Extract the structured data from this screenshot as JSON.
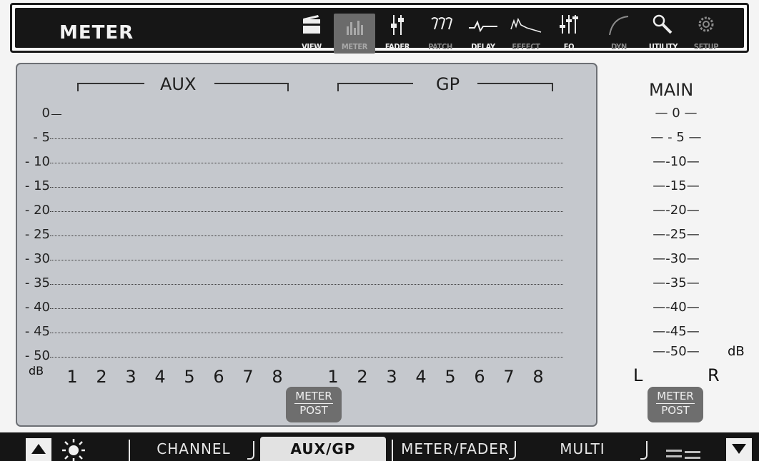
{
  "header": {
    "title": "METER",
    "nav": [
      {
        "label": "VIEW",
        "icon": "view-icon",
        "state": "normal"
      },
      {
        "label": "METER",
        "icon": "meter-icon",
        "state": "active"
      },
      {
        "label": "FADER",
        "icon": "fader-icon",
        "state": "normal"
      },
      {
        "label": "PATCH",
        "icon": "patch-icon",
        "state": "dim"
      },
      {
        "label": "DELAY",
        "icon": "delay-icon",
        "state": "normal"
      },
      {
        "label": "EFFECT",
        "icon": "effect-icon",
        "state": "dim"
      },
      {
        "label": "EQ",
        "icon": "eq-icon",
        "state": "normal"
      },
      {
        "label": "DYN",
        "icon": "dyn-icon",
        "state": "dim"
      },
      {
        "label": "UTILITY",
        "icon": "utility-icon",
        "state": "normal"
      },
      {
        "label": "SETUP",
        "icon": "setup-icon",
        "state": "dim"
      }
    ]
  },
  "panel": {
    "aux_label": "AUX",
    "gp_label": "GP",
    "scale": [
      "0",
      "- 5",
      "- 10",
      "- 15",
      "- 20",
      "- 25",
      "- 30",
      "- 35",
      "- 40",
      "- 45",
      "- 50"
    ],
    "db_label": "dB",
    "aux_channels": [
      "1",
      "2",
      "3",
      "4",
      "5",
      "6",
      "7",
      "8"
    ],
    "gp_channels": [
      "1",
      "2",
      "3",
      "4",
      "5",
      "6",
      "7",
      "8"
    ],
    "meter_post": {
      "top": "METER",
      "bottom": "POST"
    }
  },
  "main": {
    "title": "MAIN",
    "scale": [
      "0",
      "- 5",
      "-10",
      "-15",
      "-20",
      "-25",
      "-30",
      "-35",
      "-40",
      "-45",
      "-50"
    ],
    "db_label": "dB",
    "left": "L",
    "right": "R",
    "meter_post": {
      "top": "METER",
      "bottom": "POST"
    }
  },
  "bottombar": {
    "tabs": [
      "CHANNEL",
      "AUX/GP",
      "METER/FADER",
      "MULTI"
    ],
    "active_tab": "AUX/GP"
  },
  "colors": {
    "panel_bg": "#c5c8cd",
    "header_bg": "#161616",
    "button_gray": "#6e6e6e",
    "active_tab_bg": "#e2e2e2"
  }
}
